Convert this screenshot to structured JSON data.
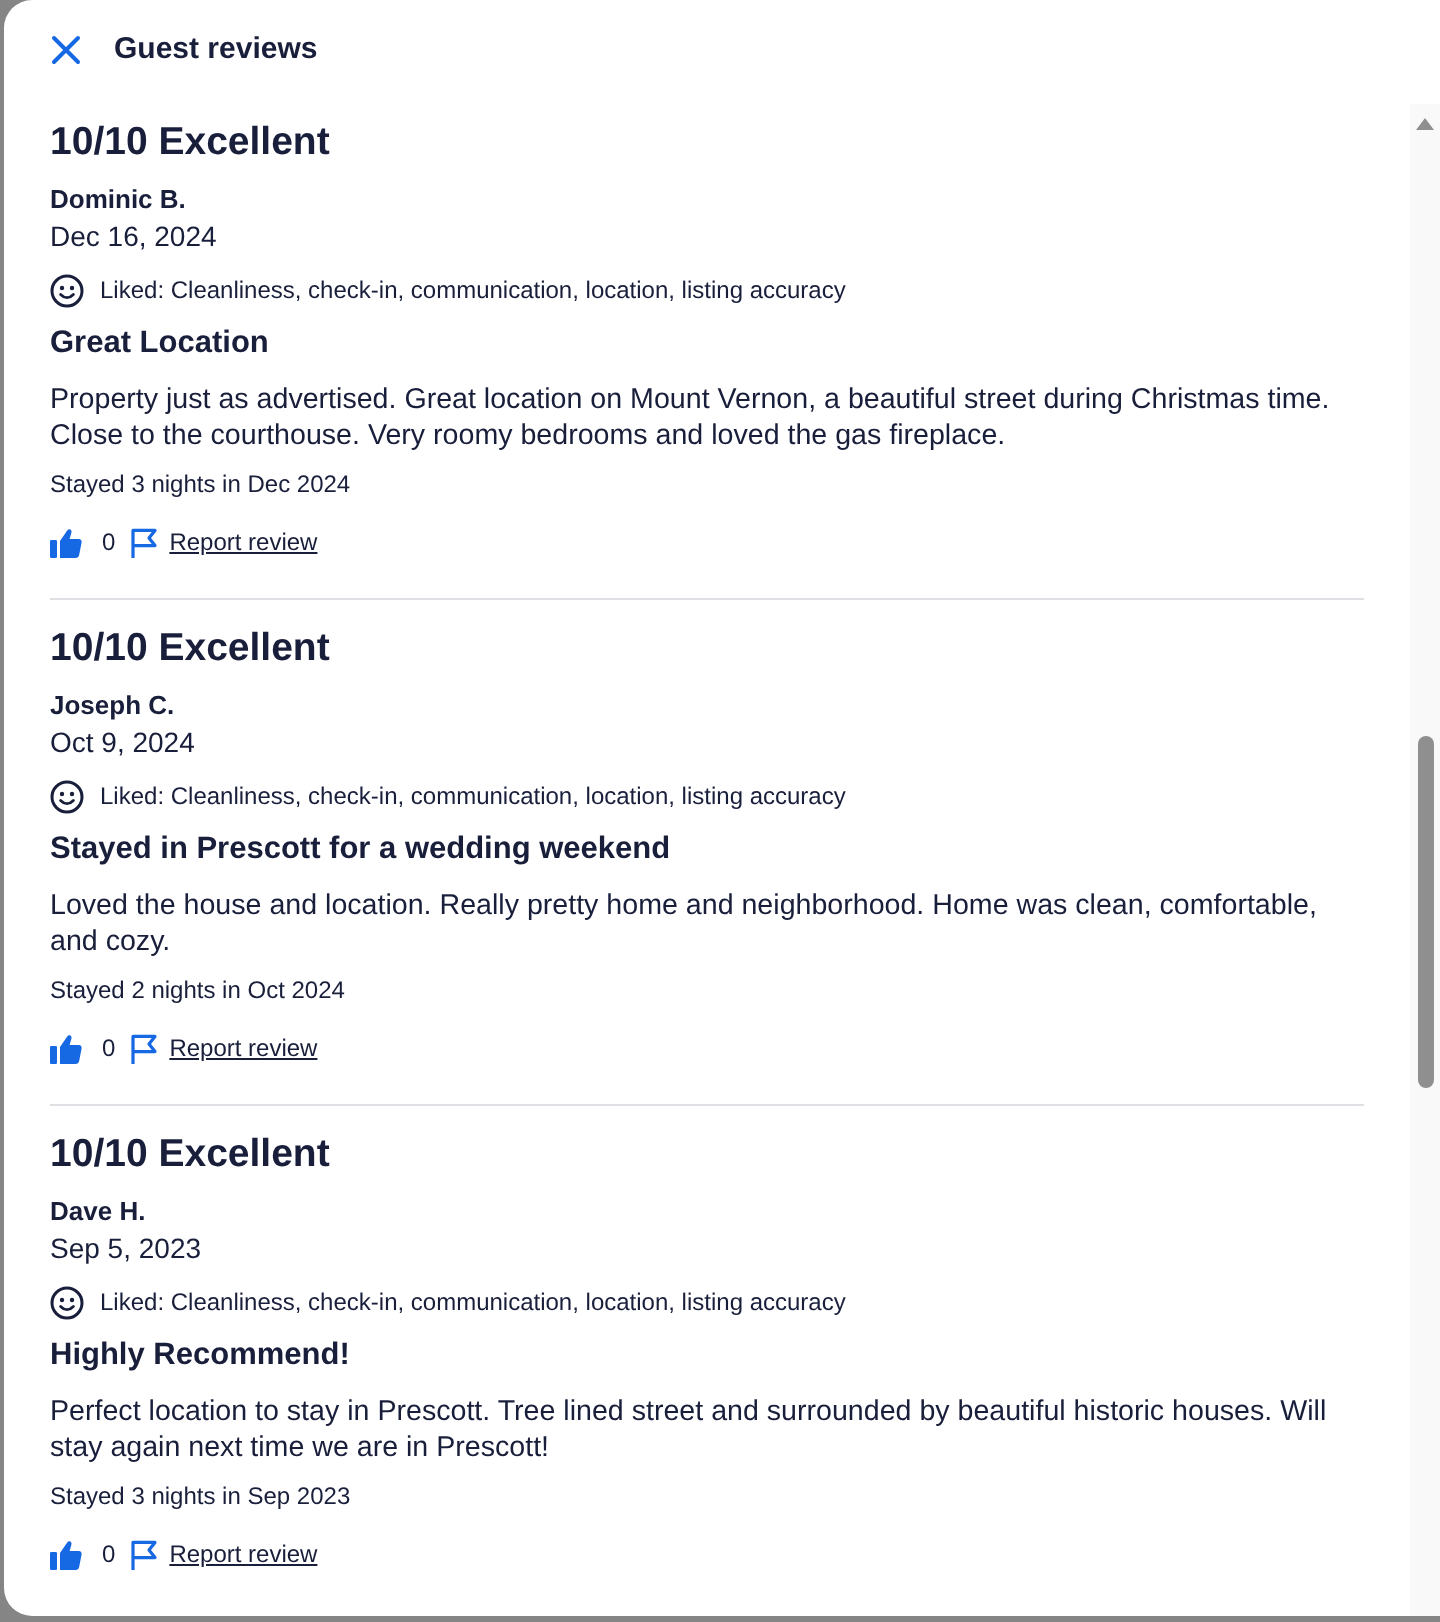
{
  "header": {
    "title": "Guest reviews"
  },
  "reviews": [
    {
      "rating": "10/10 Excellent",
      "author": "Dominic B.",
      "date": "Dec 16, 2024",
      "liked": "Liked: Cleanliness, check-in, communication, location, listing accuracy",
      "title": "Great Location",
      "body": "Property just as advertised. Great location on Mount Vernon, a beautiful street during Christmas time. Close to the courthouse. Very roomy bedrooms and loved the gas fireplace.",
      "stay": "Stayed 3 nights in Dec 2024",
      "helpful_count": "0",
      "report_link": "Report review"
    },
    {
      "rating": "10/10 Excellent",
      "author": "Joseph C.",
      "date": "Oct 9, 2024",
      "liked": "Liked: Cleanliness, check-in, communication, location, listing accuracy",
      "title": "Stayed in Prescott for a wedding weekend",
      "body": "Loved the house and location. Really pretty home and neighborhood. Home was clean, comfortable, and cozy.",
      "stay": "Stayed 2 nights in Oct 2024",
      "helpful_count": "0",
      "report_link": "Report review"
    },
    {
      "rating": "10/10 Excellent",
      "author": "Dave H.",
      "date": "Sep 5, 2023",
      "liked": "Liked: Cleanliness, check-in, communication, location, listing accuracy",
      "title": "Highly Recommend!",
      "body": "Perfect location to stay in Prescott. Tree lined street and surrounded by beautiful historic houses. Will stay again next time we are in Prescott!",
      "stay": "Stayed 3 nights in Sep 2023",
      "helpful_count": "0",
      "report_link": "Report review"
    }
  ]
}
